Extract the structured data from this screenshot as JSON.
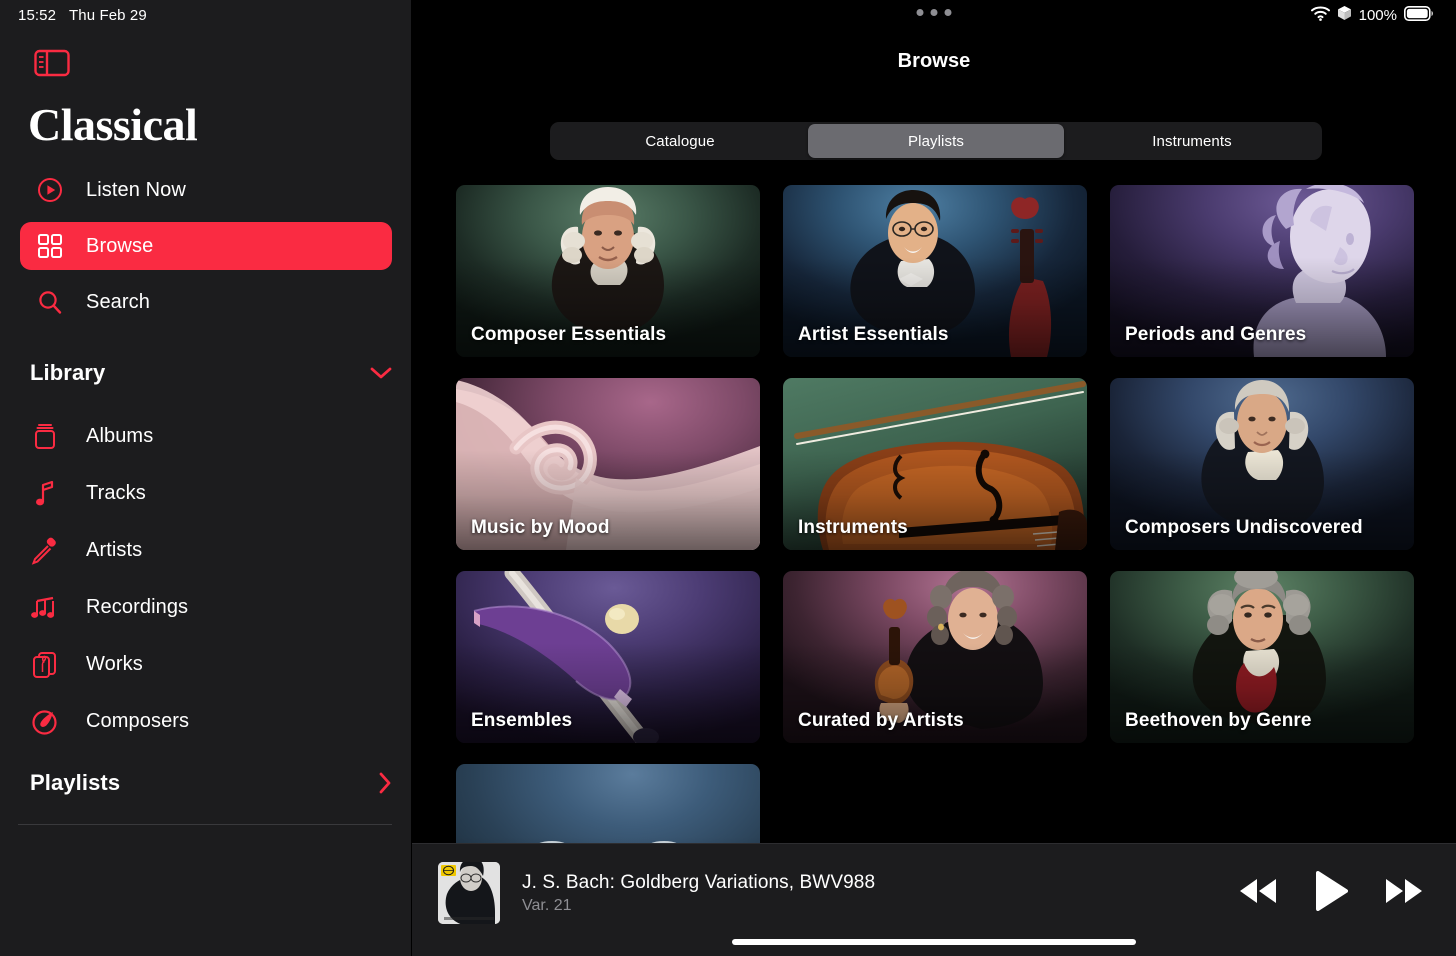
{
  "status": {
    "time": "15:52",
    "date": "Thu Feb 29",
    "battery_percent": "100%",
    "wifi_icon": "wifi-icon",
    "battery_icon": "battery-icon",
    "airdrop_icon": "package-icon"
  },
  "sidebar": {
    "toggle_icon": "sidebar-toggle-icon",
    "app_title": "Classical",
    "nav": [
      {
        "label": "Listen Now",
        "icon": "play-circle-icon",
        "selected": false
      },
      {
        "label": "Browse",
        "icon": "grid-icon",
        "selected": true
      },
      {
        "label": "Search",
        "icon": "search-icon",
        "selected": false
      }
    ],
    "library": {
      "title": "Library",
      "chevron": "chevron-down-icon",
      "items": [
        {
          "label": "Albums",
          "icon": "album-icon"
        },
        {
          "label": "Tracks",
          "icon": "music-note-icon"
        },
        {
          "label": "Artists",
          "icon": "microphone-icon"
        },
        {
          "label": "Recordings",
          "icon": "music-notes-icon"
        },
        {
          "label": "Works",
          "icon": "works-icon"
        },
        {
          "label": "Composers",
          "icon": "composer-icon"
        }
      ]
    },
    "playlists": {
      "title": "Playlists",
      "chevron": "chevron-right-icon"
    }
  },
  "main": {
    "page_title": "Browse",
    "segments": [
      {
        "label": "Catalogue",
        "active": false
      },
      {
        "label": "Playlists",
        "active": true
      },
      {
        "label": "Instruments",
        "active": false
      }
    ],
    "cards": [
      {
        "caption": "Composer Essentials",
        "art": "bach-portrait"
      },
      {
        "caption": "Artist Essentials",
        "art": "cellist-portrait"
      },
      {
        "caption": "Periods and Genres",
        "art": "marble-bust"
      },
      {
        "caption": "Music by Mood",
        "art": "pink-silk"
      },
      {
        "caption": "Instruments",
        "art": "violin"
      },
      {
        "caption": "Composers Undiscovered",
        "art": "haydn-portrait"
      },
      {
        "caption": "Ensembles",
        "art": "purple-abstract"
      },
      {
        "caption": "Curated by Artists",
        "art": "violinist-portrait"
      },
      {
        "caption": "Beethoven by Genre",
        "art": "beethoven-portrait"
      },
      {
        "caption": "",
        "art": "blue-abstract"
      }
    ]
  },
  "now_playing": {
    "title": "J. S. Bach: Goldberg Variations, BWV988",
    "subtitle": "Var. 21",
    "artwork": "album-artwork",
    "controls": [
      {
        "name": "rewind-button",
        "icon": "rewind-icon"
      },
      {
        "name": "play-button",
        "icon": "play-icon"
      },
      {
        "name": "forward-button",
        "icon": "fast-forward-icon"
      }
    ]
  },
  "colors": {
    "accent": "#FA2B42",
    "sidebar_bg": "#1C1C1E",
    "main_bg": "#000000",
    "secondary_text": "#8E8E93",
    "segment_active": "#6B6B70"
  }
}
